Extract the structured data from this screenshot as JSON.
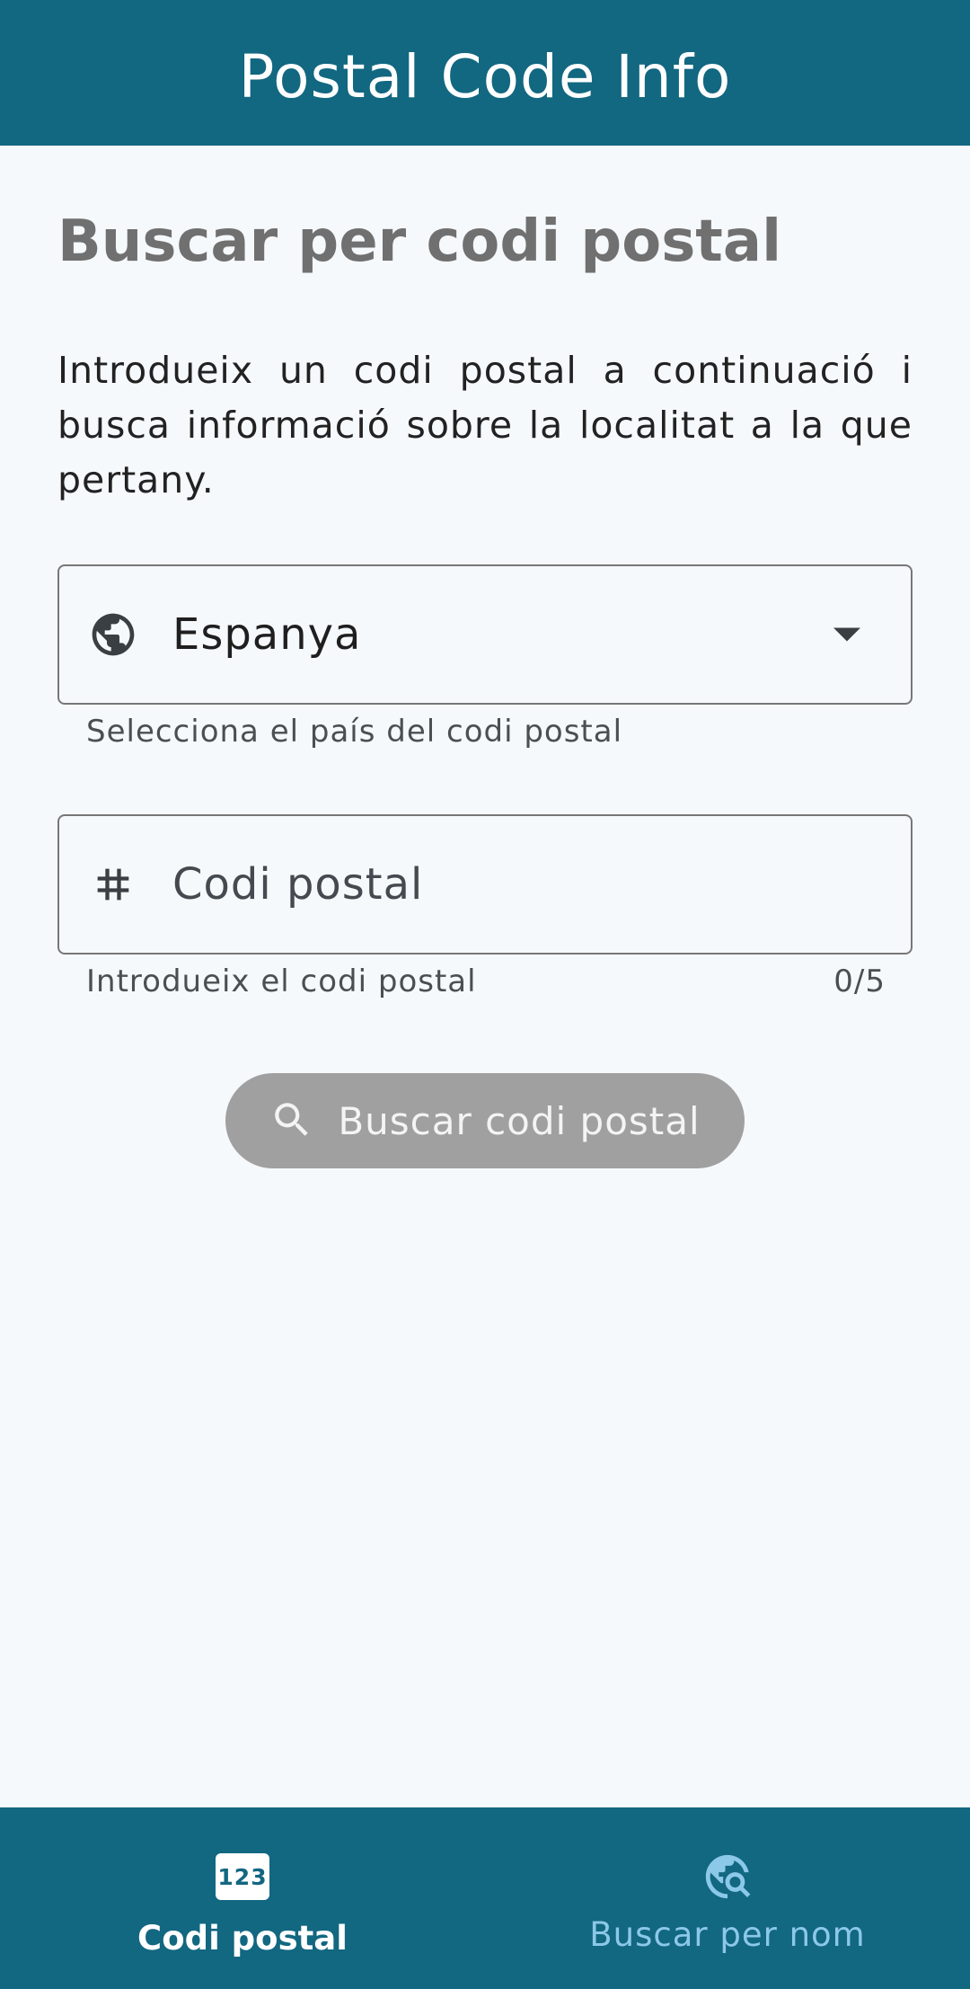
{
  "app_bar": {
    "title": "Postal Code Info"
  },
  "main": {
    "heading": "Buscar per codi postal",
    "intro": "Introdueix un codi postal a continuació i busca informació sobre la localitat a la que pertany.",
    "country_field": {
      "value": "Espanya",
      "icon": "globe-icon",
      "helper": "Selecciona el país del codi postal"
    },
    "postal_field": {
      "placeholder": "Codi postal",
      "icon": "hash-icon",
      "helper": "Introdueix el codi postal",
      "counter": "0/5"
    },
    "search_button": {
      "label": "Buscar codi postal",
      "icon": "search-icon"
    }
  },
  "bottom_nav": {
    "items": [
      {
        "label": "Codi postal",
        "icon": "numbers-123-icon",
        "badge": "123",
        "active": true
      },
      {
        "label": "Buscar per nom",
        "icon": "travel-explore-icon",
        "active": false
      }
    ]
  },
  "colors": {
    "primary": "#126781",
    "background": "#f6f9fc",
    "heading": "#707070",
    "button_disabled": "#a0a0a0",
    "nav_inactive": "#8cc8e8"
  }
}
